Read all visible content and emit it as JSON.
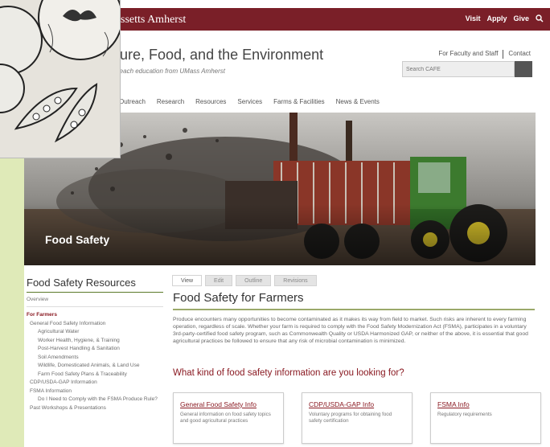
{
  "header": {
    "brand": "ssetts Amherst",
    "utility_links": [
      "Visit",
      "Apply",
      "Give"
    ],
    "search_icon": "search-icon"
  },
  "site": {
    "title": "lture, Food, and the Environment",
    "tagline": "reach education from UMass Amherst"
  },
  "util_nav": {
    "faculty": "For Faculty and Staff",
    "contact": "Contact"
  },
  "search": {
    "placeholder": "Search CAFE"
  },
  "main_nav": [
    "Outreach",
    "Research",
    "Resources",
    "Services",
    "Farms & Facilities",
    "News & Events"
  ],
  "hero": {
    "title": "Food Safety"
  },
  "sidebar": {
    "title": "Food Safety Resources",
    "items": [
      {
        "label": "Overview",
        "level": 0
      },
      {
        "label": "For Farmers",
        "level": 0,
        "active": true
      },
      {
        "label": "General Food Safety Information",
        "level": 1
      },
      {
        "label": "Agricultural Water",
        "level": 2
      },
      {
        "label": "Worker Health, Hygiene, & Training",
        "level": 2
      },
      {
        "label": "Post-Harvest Handling & Sanitation",
        "level": 2
      },
      {
        "label": "Soil Amendments",
        "level": 2
      },
      {
        "label": "Wildlife, Domesticated Animals, & Land Use",
        "level": 2
      },
      {
        "label": "Farm Food Safety Plans & Traceability",
        "level": 2
      },
      {
        "label": "CDP/USDA-GAP Information",
        "level": 1
      },
      {
        "label": "FSMA Information",
        "level": 1
      },
      {
        "label": "Do I Need to Comply with the FSMA Produce Rule?",
        "level": 2
      },
      {
        "label": "Past Workshops & Presentations",
        "level": 1
      }
    ]
  },
  "tabs": [
    "View",
    "Edit",
    "Outline",
    "Revisions"
  ],
  "content": {
    "title": "Food Safety for Farmers",
    "intro": "Produce encounters many opportunities to become contaminated as it makes its way from field to market. Such risks are inherent to every farming operation, regardless of scale. Whether your farm is required to comply with the Food Safety Modernization Act (FSMA), participates in a voluntary 3rd-party-certified food safety program, such as Commonwealth Quality or USDA Harmonized GAP, or neither of the above, it is essential that good agricultural practices be followed to ensure that any risk of microbial contamination is minimized.",
    "question": "What kind of food safety information are you looking for?"
  },
  "cards": [
    {
      "title": "General Food Safety Info",
      "desc": "General information on food safety topics and good agricultural practices"
    },
    {
      "title": "CDP/USDA-GAP Info",
      "desc": "Voluntary programs for obtaining food safety certification"
    },
    {
      "title": "FSMA Info",
      "desc": "Regulatory requirements"
    }
  ],
  "colors": {
    "brand": "#7a1f28",
    "accent": "#8a1a22",
    "rule": "#9aa96a",
    "background": "#dfeab8"
  }
}
